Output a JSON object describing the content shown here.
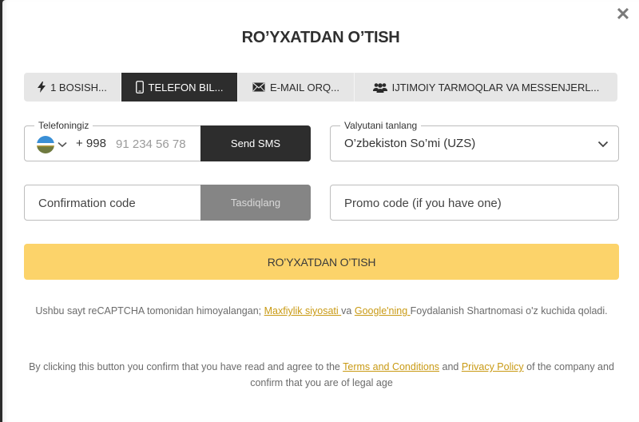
{
  "modal": {
    "title": "RO’YXATDAN O’TISH",
    "close_icon": "close-icon"
  },
  "tabs": [
    {
      "label": "1 BOSISH...",
      "icon": "lightning-icon",
      "active": false
    },
    {
      "label": "TELEFON BIL...",
      "icon": "phone-icon",
      "active": true
    },
    {
      "label": "E-MAIL ORQ...",
      "icon": "envelope-icon",
      "active": false
    },
    {
      "label": "IJTIMOIY TARMOQLAR VA MESSENJERL...",
      "icon": "users-icon",
      "active": false
    }
  ],
  "phone": {
    "legend": "Telefoningiz",
    "country_flag": "uzbekistan-flag-icon",
    "prefix": "+ 998",
    "placeholder": "91 234 56 78",
    "send_sms_label": "Send SMS"
  },
  "currency": {
    "legend": "Valyutani tanlang",
    "selected": "O’zbekiston So’mi (UZS)"
  },
  "confirmation": {
    "placeholder": "Confirmation code",
    "confirm_label": "Tasdiqlang"
  },
  "promo": {
    "placeholder": "Promo code (if you have one)"
  },
  "register_button": "RO’YXATDAN O’TISH",
  "recaptcha_note": {
    "text_before": "Ushbu sayt reCAPTCHA tomonidan himoyalangan; ",
    "privacy_link": "Maxfiylik siyosati ",
    "text_mid": "va ",
    "google_link": "Google'ning ",
    "text_after": "Foydalanish Shartnomasi o'z kuchida qoladi."
  },
  "terms_note": {
    "text_before": "By clicking this button you confirm that you have read and agree to the ",
    "terms_link": "Terms and Conditions",
    "text_mid": " and ",
    "privacy_link": "Privacy Policy",
    "text_after": " of the company and confirm that you are of legal age"
  },
  "colors": {
    "accent_yellow": "#fcd36a",
    "active_tab": "#2d2d2d",
    "link": "#c99a14"
  }
}
